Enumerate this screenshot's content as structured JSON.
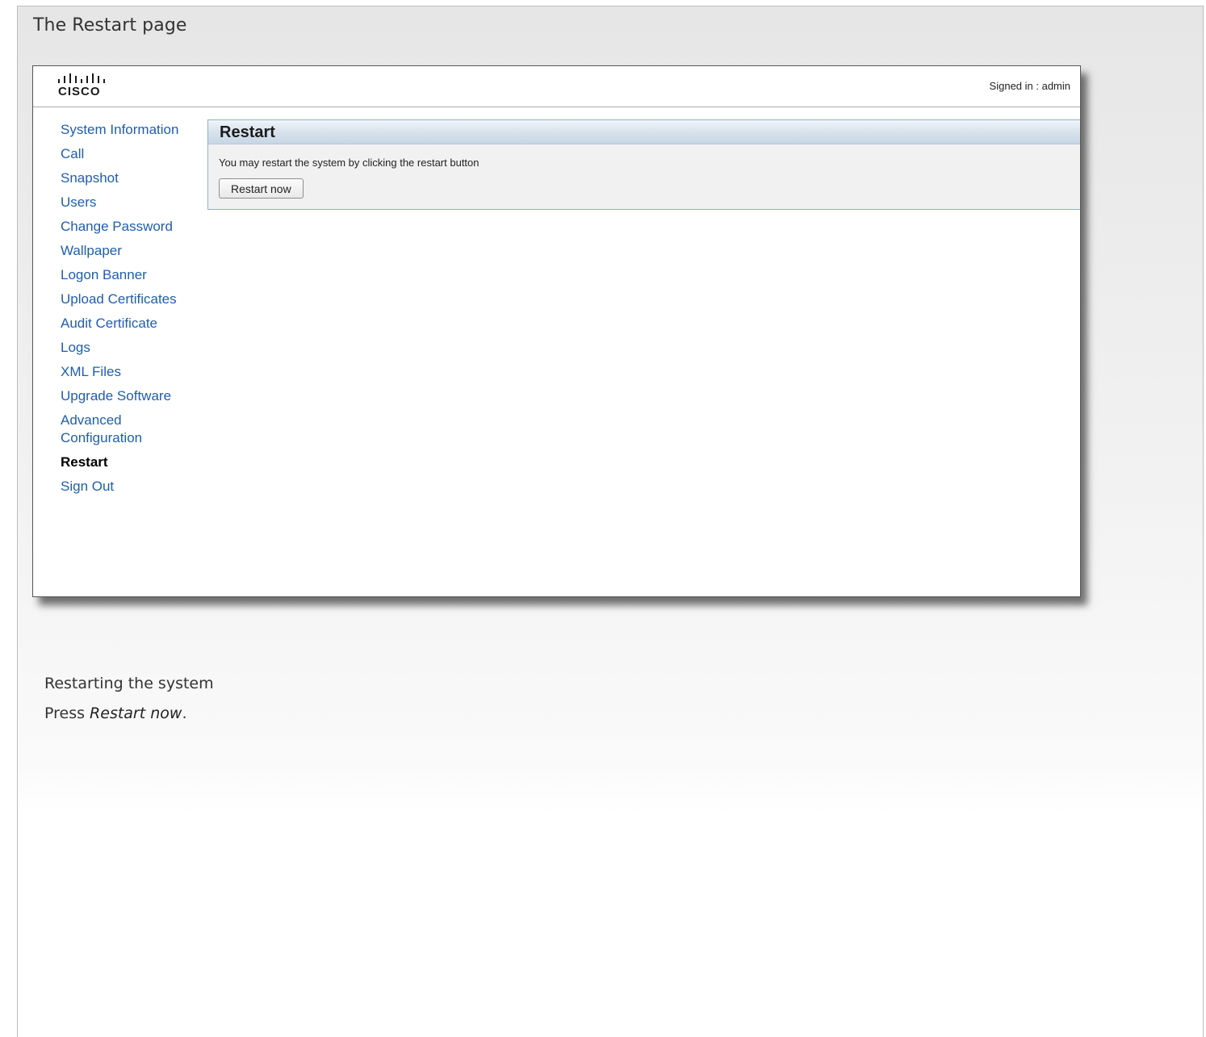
{
  "document": {
    "title": "The Restart page",
    "caption": "Restarting the system",
    "instruction_prefix": "Press ",
    "instruction_emphasis": "Restart now",
    "instruction_suffix": "."
  },
  "app": {
    "logo_text": "CISCO",
    "logo_icon": "cisco-logo",
    "signed_in_text": "Signed in : admin"
  },
  "nav": {
    "items": [
      {
        "label": "System Information",
        "active": false
      },
      {
        "label": "Call",
        "active": false
      },
      {
        "label": "Snapshot",
        "active": false
      },
      {
        "label": "Users",
        "active": false
      },
      {
        "label": "Change Password",
        "active": false
      },
      {
        "label": "Wallpaper",
        "active": false
      },
      {
        "label": "Logon Banner",
        "active": false
      },
      {
        "label": "Upload Certificates",
        "active": false
      },
      {
        "label": "Audit Certificate",
        "active": false
      },
      {
        "label": "Logs",
        "active": false
      },
      {
        "label": "XML Files",
        "active": false
      },
      {
        "label": "Upgrade Software",
        "active": false
      },
      {
        "label": "Advanced Configuration",
        "active": false
      },
      {
        "label": "Restart",
        "active": true
      },
      {
        "label": "Sign Out",
        "active": false
      }
    ]
  },
  "restart_panel": {
    "title": "Restart",
    "description": "You may restart the system by clicking the restart button",
    "button_label": "Restart now"
  },
  "colors": {
    "link": "#1f5eae",
    "panel_border": "#8fb0cc",
    "panel_header": "#d6e1ec"
  }
}
